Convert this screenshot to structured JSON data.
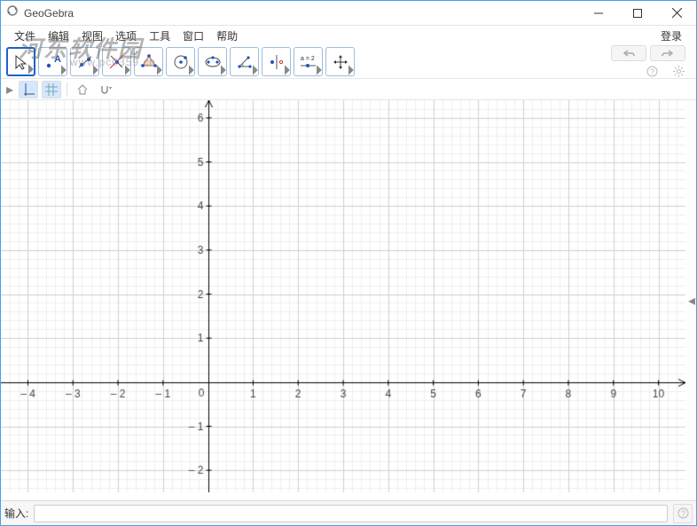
{
  "title": "GeoGebra",
  "watermark": "河东软件园",
  "watermark_url": "www.pc0359.cn",
  "menu": [
    "文件",
    "编辑",
    "视图",
    "选项",
    "工具",
    "窗口",
    "帮助"
  ],
  "login": "登录",
  "slider_label": "a = 2",
  "input": {
    "label": "输入:",
    "value": "",
    "placeholder": ""
  },
  "help_symbol": "?",
  "tools": [
    "move",
    "point",
    "line",
    "perpendicular",
    "polygon",
    "circle",
    "ellipse",
    "angle",
    "reflect",
    "slider",
    "move-graph"
  ],
  "chart_data": {
    "type": "scatter",
    "series": [],
    "x_ticks": [
      -4,
      -3,
      -2,
      -1,
      0,
      1,
      2,
      3,
      4,
      5,
      6,
      7,
      8,
      9,
      10
    ],
    "y_ticks": [
      -2,
      -1,
      1,
      2,
      3,
      4,
      5,
      6
    ],
    "xlim": [
      -4.6,
      10.6
    ],
    "ylim": [
      -2.5,
      6.4
    ],
    "origin_label": "0",
    "grid_major": 1,
    "grid_minor": 0.2,
    "title": "",
    "xlabel": "",
    "ylabel": ""
  }
}
